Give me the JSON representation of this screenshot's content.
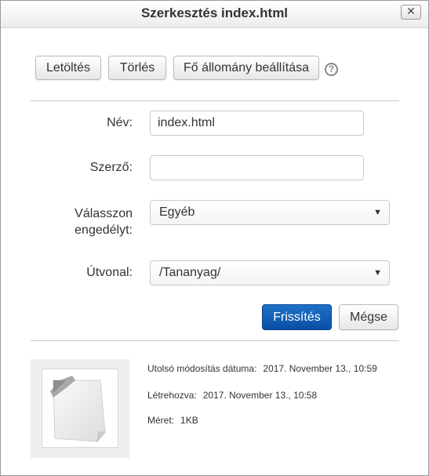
{
  "dialog": {
    "title": "Szerkesztés index.html",
    "close_icon": "close-icon"
  },
  "toolbar": {
    "download_label": "Letöltés",
    "delete_label": "Törlés",
    "set_main_label": "Fő állomány beállítása",
    "help_icon": "question-mark-icon"
  },
  "form": {
    "name_label": "Név:",
    "name_value": "index.html",
    "author_label": "Szerző:",
    "author_value": "",
    "license_label_line1": "Válasszon",
    "license_label_line2": "engedélyt:",
    "license_value": "Egyéb",
    "path_label": "Útvonal:",
    "path_value": "/Tananyag/",
    "update_label": "Frissítés",
    "cancel_label": "Mégse"
  },
  "file_info": {
    "thumbnail_icon": "generic-file-icon",
    "modified_label": "Utolsó módosítás dátuma:",
    "modified_value": "2017. November 13., 10:59",
    "created_label": "Létrehozva:",
    "created_value": "2017. November 13., 10:58",
    "size_label": "Méret:",
    "size_value": "1KB"
  },
  "colors": {
    "primary_button": "#0a4ea5",
    "divider": "#c8c8c8"
  }
}
